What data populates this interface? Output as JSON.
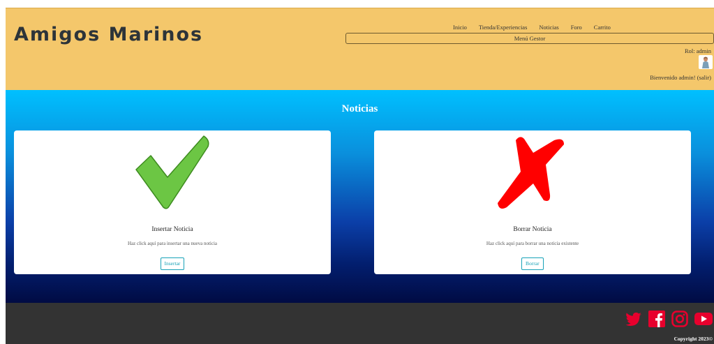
{
  "header": {
    "logo": "Amigos Marinos",
    "nav": [
      "Inicio",
      "Tienda/Experiencias",
      "Noticias",
      "Foro",
      "Carrito"
    ],
    "menu_gestor": "Menú Gestor",
    "rol": "Rol: admin",
    "welcome": "Bienvenido admin! (salir)"
  },
  "main": {
    "title": "Noticias",
    "cards": [
      {
        "icon": "checkmark-icon",
        "title": "Insertar Noticia",
        "text": "Haz click aquí para insertar una nueva noticia",
        "button": "Insertar",
        "color": "#6cc644"
      },
      {
        "icon": "x-mark-icon",
        "title": "Borrar Noticia",
        "text": "Haz click aquí para borrar una noticia existente",
        "button": "Borrar",
        "color": "#ff0000"
      }
    ]
  },
  "footer": {
    "social": [
      "twitter-icon",
      "facebook-icon",
      "instagram-icon",
      "youtube-icon"
    ],
    "social_color": "#e8002d",
    "copyright": "Copyright 2023©"
  }
}
